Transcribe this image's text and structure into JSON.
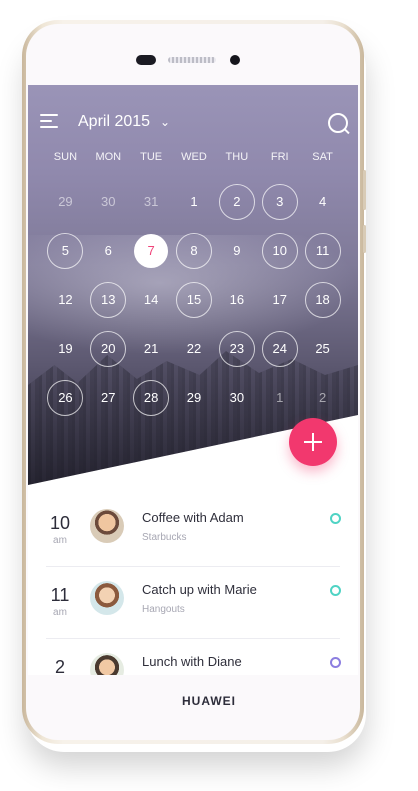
{
  "device": {
    "brand": "HUAWEI"
  },
  "header": {
    "month_title": "April 2015"
  },
  "weekdays": [
    "SUN",
    "MON",
    "TUE",
    "WED",
    "THU",
    "FRI",
    "SAT"
  ],
  "calendar": {
    "days": [
      {
        "label": "29",
        "muted": true,
        "ring": false,
        "today": false
      },
      {
        "label": "30",
        "muted": true,
        "ring": false,
        "today": false
      },
      {
        "label": "31",
        "muted": true,
        "ring": false,
        "today": false
      },
      {
        "label": "1",
        "muted": false,
        "ring": false,
        "today": false
      },
      {
        "label": "2",
        "muted": false,
        "ring": true,
        "today": false
      },
      {
        "label": "3",
        "muted": false,
        "ring": true,
        "today": false
      },
      {
        "label": "4",
        "muted": false,
        "ring": false,
        "today": false
      },
      {
        "label": "5",
        "muted": false,
        "ring": true,
        "today": false
      },
      {
        "label": "6",
        "muted": false,
        "ring": false,
        "today": false
      },
      {
        "label": "7",
        "muted": false,
        "ring": false,
        "today": true
      },
      {
        "label": "8",
        "muted": false,
        "ring": true,
        "today": false
      },
      {
        "label": "9",
        "muted": false,
        "ring": false,
        "today": false
      },
      {
        "label": "10",
        "muted": false,
        "ring": true,
        "today": false
      },
      {
        "label": "11",
        "muted": false,
        "ring": true,
        "today": false
      },
      {
        "label": "12",
        "muted": false,
        "ring": false,
        "today": false
      },
      {
        "label": "13",
        "muted": false,
        "ring": true,
        "today": false
      },
      {
        "label": "14",
        "muted": false,
        "ring": false,
        "today": false
      },
      {
        "label": "15",
        "muted": false,
        "ring": true,
        "today": false
      },
      {
        "label": "16",
        "muted": false,
        "ring": false,
        "today": false
      },
      {
        "label": "17",
        "muted": false,
        "ring": false,
        "today": false
      },
      {
        "label": "18",
        "muted": false,
        "ring": true,
        "today": false
      },
      {
        "label": "19",
        "muted": false,
        "ring": false,
        "today": false
      },
      {
        "label": "20",
        "muted": false,
        "ring": true,
        "today": false
      },
      {
        "label": "21",
        "muted": false,
        "ring": false,
        "today": false
      },
      {
        "label": "22",
        "muted": false,
        "ring": false,
        "today": false
      },
      {
        "label": "23",
        "muted": false,
        "ring": true,
        "today": false
      },
      {
        "label": "24",
        "muted": false,
        "ring": true,
        "today": false
      },
      {
        "label": "25",
        "muted": false,
        "ring": false,
        "today": false
      },
      {
        "label": "26",
        "muted": false,
        "ring": true,
        "today": false
      },
      {
        "label": "27",
        "muted": false,
        "ring": false,
        "today": false
      },
      {
        "label": "28",
        "muted": false,
        "ring": true,
        "today": false
      },
      {
        "label": "29",
        "muted": false,
        "ring": false,
        "today": false
      },
      {
        "label": "30",
        "muted": false,
        "ring": false,
        "today": false
      },
      {
        "label": "1",
        "muted": true,
        "ring": false,
        "today": false
      },
      {
        "label": "2",
        "muted": true,
        "ring": false,
        "today": false
      }
    ]
  },
  "events": [
    {
      "hour": "10",
      "ampm": "am",
      "title": "Coffee with Adam",
      "subtitle": "Starbucks",
      "dot_color": "#4fd3c4"
    },
    {
      "hour": "11",
      "ampm": "am",
      "title": "Catch up with Marie",
      "subtitle": "Hangouts",
      "dot_color": "#4fd3c4"
    },
    {
      "hour": "2",
      "ampm": "",
      "title": "Lunch with Diane",
      "subtitle": "",
      "dot_color": "#8c7ee0"
    }
  ],
  "colors": {
    "accent": "#f2386e",
    "today_text": "#f0447a"
  },
  "icons": [
    "menu-icon",
    "chevron-down-icon",
    "search-icon",
    "plus-icon"
  ]
}
